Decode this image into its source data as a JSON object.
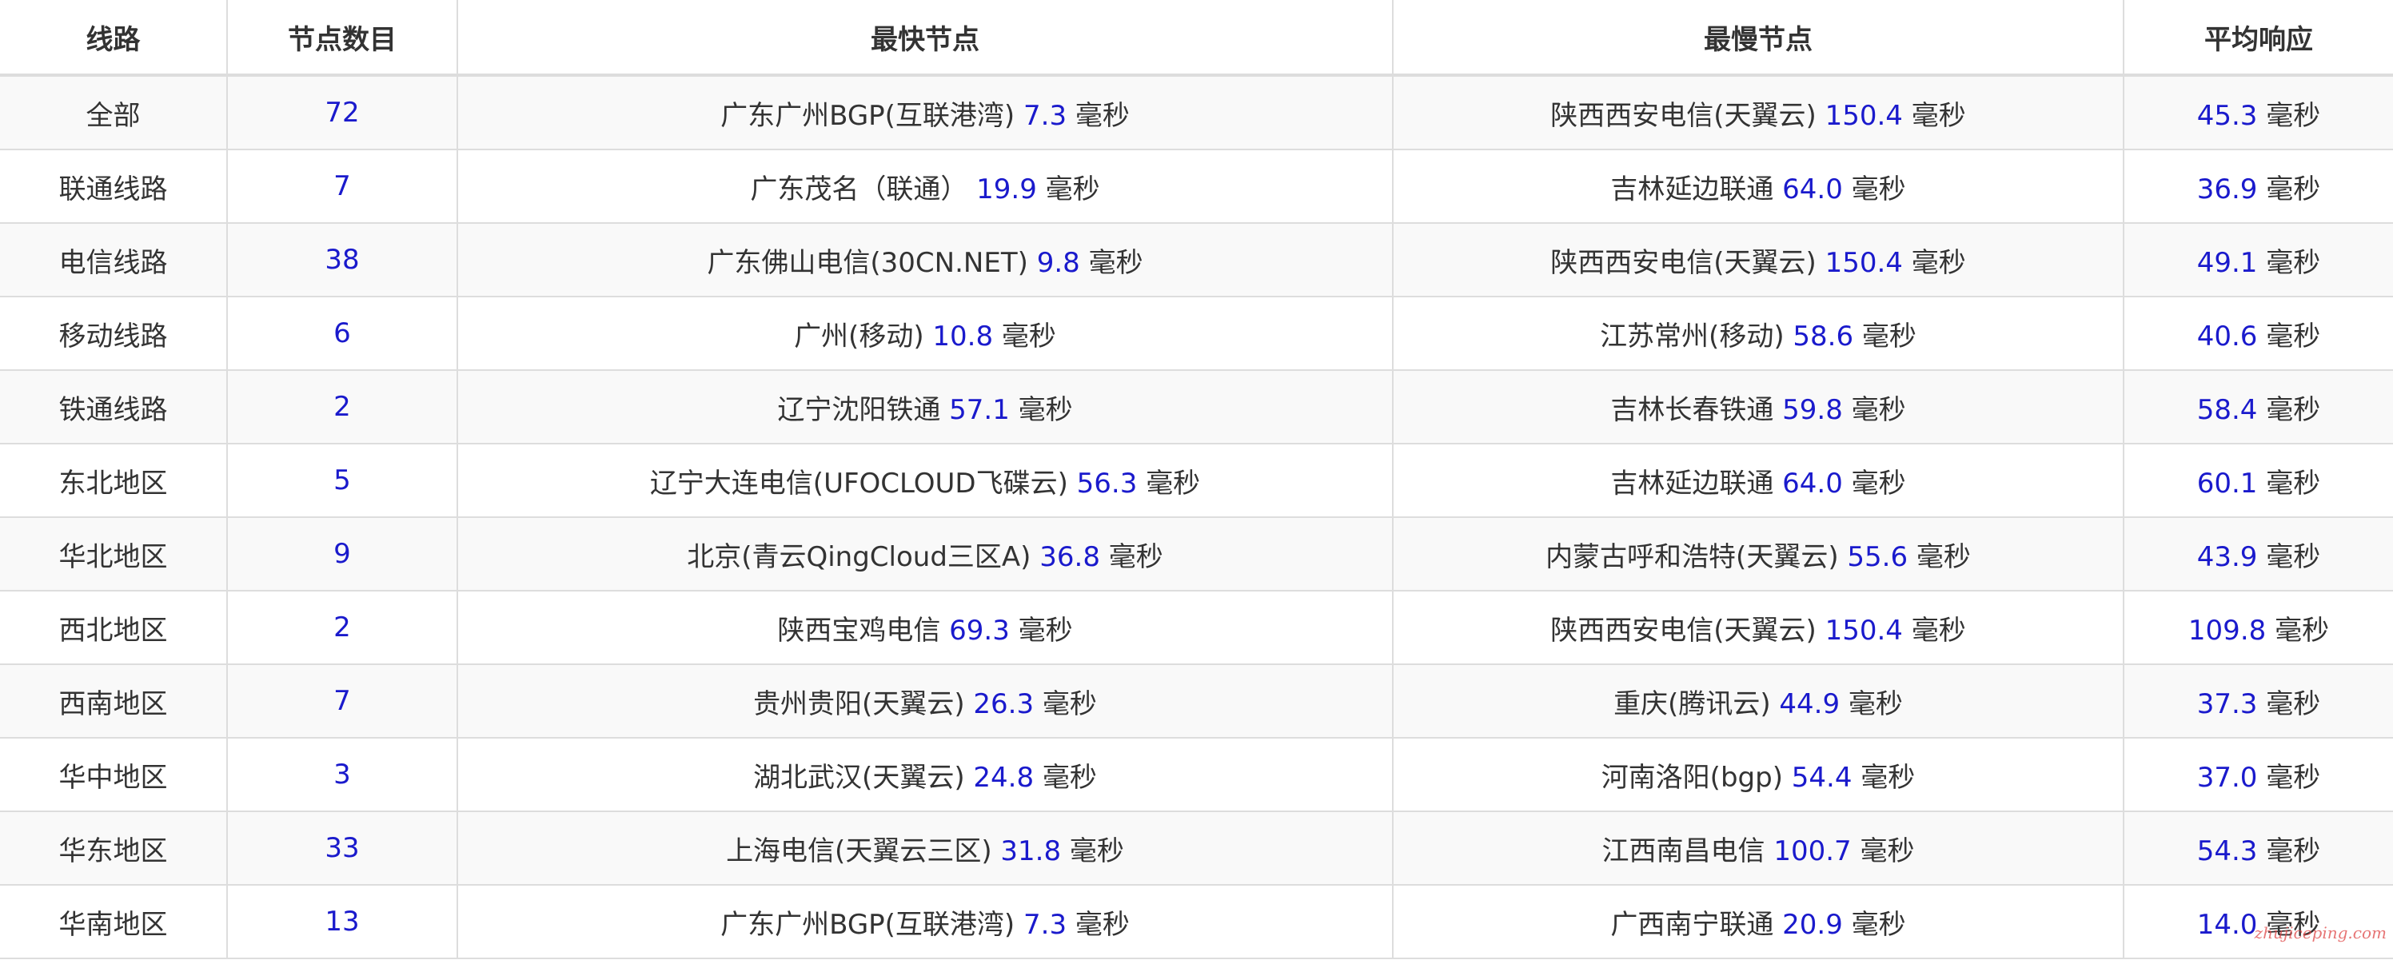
{
  "headers": [
    "线路",
    "节点数目",
    "最快节点",
    "最慢节点",
    "平均响应"
  ],
  "unit": "毫秒",
  "rows": [
    {
      "line": "全部",
      "count": "72",
      "fast_node": "广东广州BGP(互联港湾)",
      "fast_ms": "7.3",
      "slow_node": "陕西西安电信(天翼云)",
      "slow_ms": "150.4",
      "avg_ms": "45.3"
    },
    {
      "line": "联通线路",
      "count": "7",
      "fast_node": "广东茂名（联通）",
      "fast_ms": "19.9",
      "slow_node": "吉林延边联通",
      "slow_ms": "64.0",
      "avg_ms": "36.9"
    },
    {
      "line": "电信线路",
      "count": "38",
      "fast_node": "广东佛山电信(30CN.NET)",
      "fast_ms": "9.8",
      "slow_node": "陕西西安电信(天翼云)",
      "slow_ms": "150.4",
      "avg_ms": "49.1"
    },
    {
      "line": "移动线路",
      "count": "6",
      "fast_node": "广州(移动)",
      "fast_ms": "10.8",
      "slow_node": "江苏常州(移动)",
      "slow_ms": "58.6",
      "avg_ms": "40.6"
    },
    {
      "line": "铁通线路",
      "count": "2",
      "fast_node": "辽宁沈阳铁通",
      "fast_ms": "57.1",
      "slow_node": "吉林长春铁通",
      "slow_ms": "59.8",
      "avg_ms": "58.4"
    },
    {
      "line": "东北地区",
      "count": "5",
      "fast_node": "辽宁大连电信(UFOCLOUD飞碟云)",
      "fast_ms": "56.3",
      "slow_node": "吉林延边联通",
      "slow_ms": "64.0",
      "avg_ms": "60.1"
    },
    {
      "line": "华北地区",
      "count": "9",
      "fast_node": "北京(青云QingCloud三区A)",
      "fast_ms": "36.8",
      "slow_node": "内蒙古呼和浩特(天翼云)",
      "slow_ms": "55.6",
      "avg_ms": "43.9"
    },
    {
      "line": "西北地区",
      "count": "2",
      "fast_node": "陕西宝鸡电信",
      "fast_ms": "69.3",
      "slow_node": "陕西西安电信(天翼云)",
      "slow_ms": "150.4",
      "avg_ms": "109.8"
    },
    {
      "line": "西南地区",
      "count": "7",
      "fast_node": "贵州贵阳(天翼云)",
      "fast_ms": "26.3",
      "slow_node": "重庆(腾讯云)",
      "slow_ms": "44.9",
      "avg_ms": "37.3"
    },
    {
      "line": "华中地区",
      "count": "3",
      "fast_node": "湖北武汉(天翼云)",
      "fast_ms": "24.8",
      "slow_node": "河南洛阳(bgp)",
      "slow_ms": "54.4",
      "avg_ms": "37.0"
    },
    {
      "line": "华东地区",
      "count": "33",
      "fast_node": "上海电信(天翼云三区)",
      "fast_ms": "31.8",
      "slow_node": "江西南昌电信",
      "slow_ms": "100.7",
      "avg_ms": "54.3"
    },
    {
      "line": "华南地区",
      "count": "13",
      "fast_node": "广东广州BGP(互联港湾)",
      "fast_ms": "7.3",
      "slow_node": "广西南宁联通",
      "slow_ms": "20.9",
      "avg_ms": "14.0"
    }
  ],
  "watermark": "zhujiceping.com"
}
